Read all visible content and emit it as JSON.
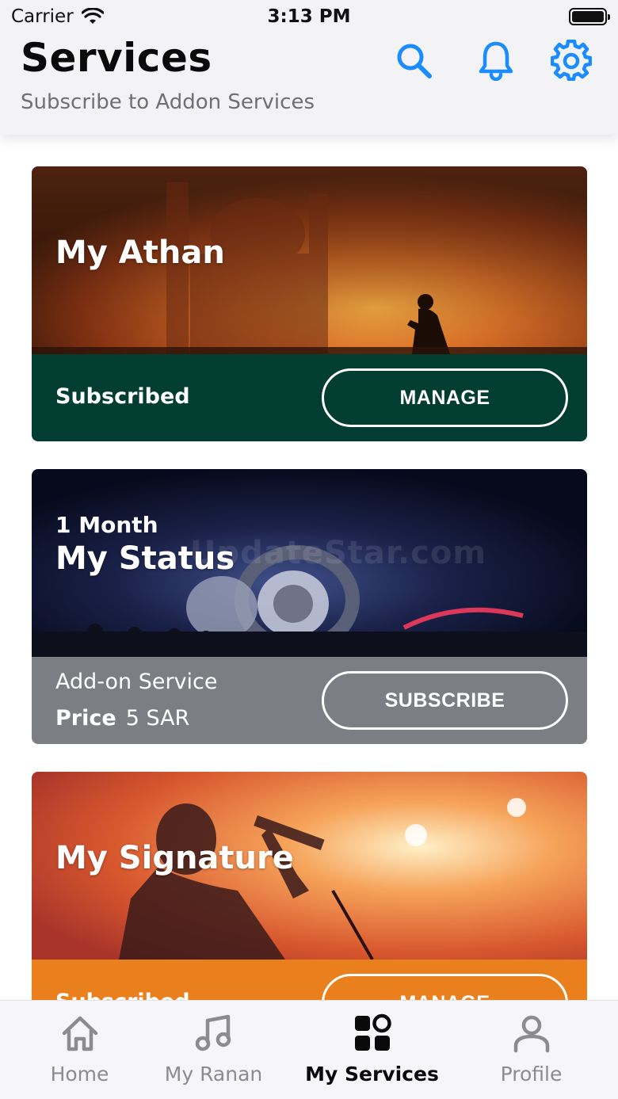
{
  "status_bar": {
    "carrier": "Carrier",
    "time": "3:13 PM"
  },
  "header": {
    "title": "Services",
    "subtitle": "Subscribe to Addon Services",
    "icons": [
      "search-icon",
      "bell-icon",
      "gear-icon"
    ],
    "accent_color": "#1a8cff"
  },
  "cards": [
    {
      "title": "My Athan",
      "status": "Subscribed",
      "button": "MANAGE",
      "footer_color": "#023d32"
    },
    {
      "overline": "1 Month",
      "title": "My Status",
      "line": "Add-on Service",
      "price_label": "Price",
      "price_value": "5 SAR",
      "button": "SUBSCRIBE",
      "footer_color": "#7d7e83"
    },
    {
      "title": "My Signature",
      "status": "Subscribed",
      "button": "MANAGE",
      "footer_color": "#e9801d"
    }
  ],
  "watermark": "UpdateStar.com",
  "tabs": [
    {
      "label": "Home",
      "icon": "home-icon",
      "active": false
    },
    {
      "label": "My Ranan",
      "icon": "music-note-icon",
      "active": false
    },
    {
      "label": "My Services",
      "icon": "services-grid-icon",
      "active": true
    },
    {
      "label": "Profile",
      "icon": "person-icon",
      "active": false
    }
  ]
}
